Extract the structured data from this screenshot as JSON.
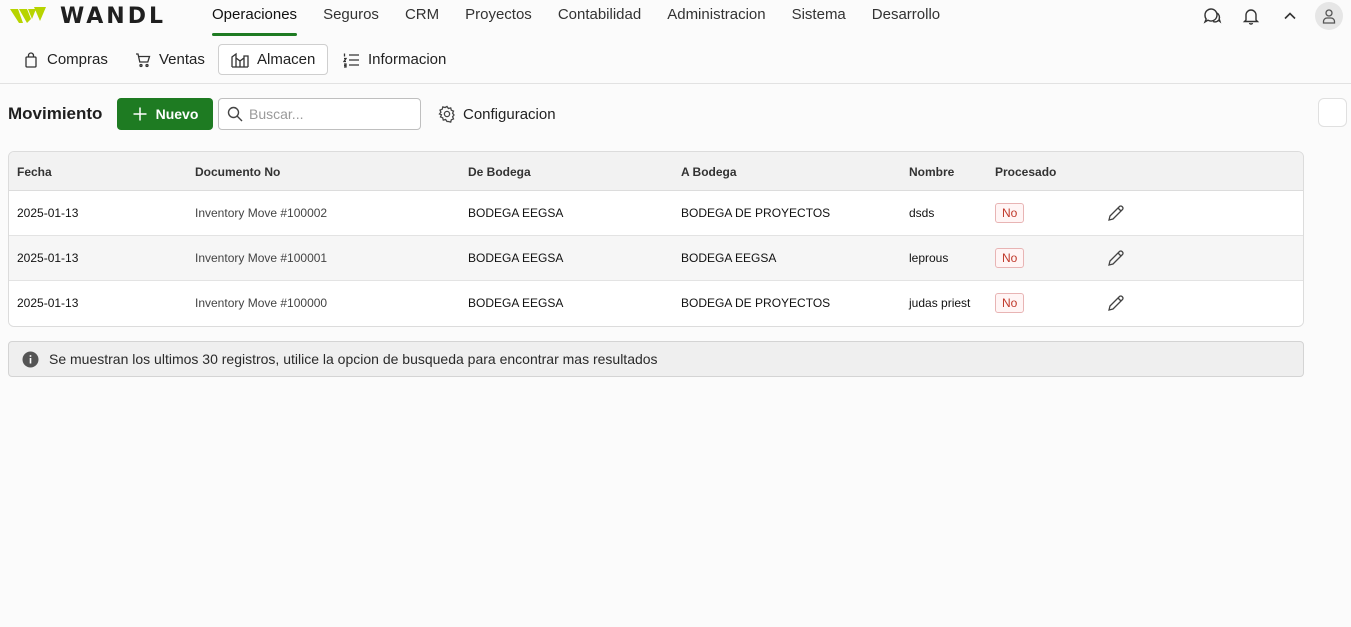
{
  "brand": {
    "logo_text": "WANDL",
    "accent": "#1e7b22",
    "logo_color": "#b7d400"
  },
  "main_nav": {
    "items": [
      {
        "label": "Operaciones",
        "active": true
      },
      {
        "label": "Seguros"
      },
      {
        "label": "CRM"
      },
      {
        "label": "Proyectos"
      },
      {
        "label": "Contabilidad"
      },
      {
        "label": "Administracion"
      },
      {
        "label": "Sistema"
      },
      {
        "label": "Desarrollo"
      }
    ]
  },
  "top_icons": [
    "chat-icon",
    "bell-icon",
    "chevron-up-icon",
    "user-icon"
  ],
  "sub_nav": {
    "items": [
      {
        "label": "Compras",
        "icon": "shopping-bag-icon"
      },
      {
        "label": "Ventas",
        "icon": "cart-icon"
      },
      {
        "label": "Almacen",
        "icon": "warehouse-icon",
        "active": true
      },
      {
        "label": "Informacion",
        "icon": "list-icon"
      }
    ]
  },
  "toolbar": {
    "title": "Movimiento",
    "new_label": "Nuevo",
    "search_placeholder": "Buscar...",
    "config_label": "Configuracion"
  },
  "table": {
    "headers": [
      "Fecha",
      "Documento No",
      "De Bodega",
      "A Bodega",
      "Nombre",
      "Procesado"
    ],
    "rows": [
      {
        "fecha": "2025-01-13",
        "documento": "Inventory Move #100002",
        "de_bodega": "BODEGA EEGSA",
        "a_bodega": "BODEGA DE PROYECTOS",
        "nombre": "dsds",
        "procesado": "No"
      },
      {
        "fecha": "2025-01-13",
        "documento": "Inventory Move #100001",
        "de_bodega": "BODEGA EEGSA",
        "a_bodega": "BODEGA EEGSA",
        "nombre": "leprous",
        "procesado": "No"
      },
      {
        "fecha": "2025-01-13",
        "documento": "Inventory Move #100000",
        "de_bodega": "BODEGA EEGSA",
        "a_bodega": "BODEGA DE PROYECTOS",
        "nombre": "judas priest",
        "procesado": "No"
      }
    ]
  },
  "info_message": "Se muestran los ultimos 30 registros, utilice la opcion de busqueda para encontrar mas resultados"
}
